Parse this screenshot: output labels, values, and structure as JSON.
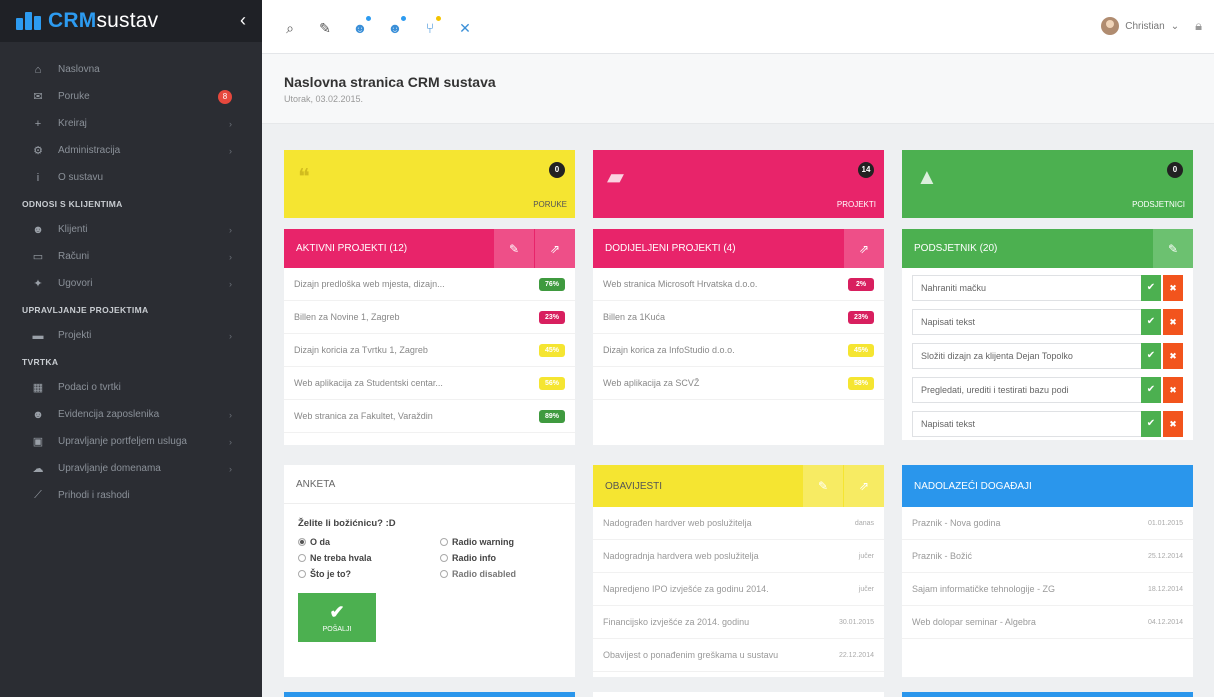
{
  "brand": {
    "name_bold": "CRM",
    "name_rest": "sustav",
    "toggle": "‹"
  },
  "sidebar": {
    "items": [
      {
        "label": "Naslovna",
        "icon": "home-icon",
        "glyph": "⌂"
      },
      {
        "label": "Poruke",
        "icon": "chat-icon",
        "glyph": "✉",
        "badge": "8"
      },
      {
        "label": "Kreiraj",
        "icon": "plus-icon",
        "glyph": "+",
        "arrow": true
      },
      {
        "label": "Administracija",
        "icon": "cogs-icon",
        "glyph": "⚙",
        "arrow": true
      },
      {
        "label": "O sustavu",
        "icon": "info-icon",
        "glyph": "i"
      }
    ],
    "section1": "ODNOSI S KLIJENTIMA",
    "items2": [
      {
        "label": "Klijenti",
        "icon": "users-icon",
        "glyph": "☻",
        "arrow": true
      },
      {
        "label": "Računi",
        "icon": "card-icon",
        "glyph": "▭",
        "arrow": true
      },
      {
        "label": "Ugovori",
        "icon": "handshake-icon",
        "glyph": "✦",
        "arrow": true
      }
    ],
    "section2": "UPRAVLJANJE PROJEKTIMA",
    "items3": [
      {
        "label": "Projekti",
        "icon": "folder-icon",
        "glyph": "▬",
        "arrow": true
      }
    ],
    "section3": "TVRTKA",
    "items4": [
      {
        "label": "Podaci o tvrtki",
        "icon": "building-icon",
        "glyph": "▦"
      },
      {
        "label": "Evidencija zaposlenika",
        "icon": "employees-icon",
        "glyph": "☻",
        "arrow": true
      },
      {
        "label": "Upravljanje portfeljem usluga",
        "icon": "portfolio-icon",
        "glyph": "▣",
        "arrow": true
      },
      {
        "label": "Upravljanje domenama",
        "icon": "cloud-icon",
        "glyph": "☁",
        "arrow": true
      },
      {
        "label": "Prihodi i rashodi",
        "icon": "line-chart-icon",
        "glyph": "⟋"
      }
    ]
  },
  "topbar": {
    "icons": [
      "search-icon",
      "wrench-icon",
      "user-add-icon",
      "users-icon",
      "hierarchy-icon",
      "fullscreen-icon"
    ],
    "user_name": "Christian",
    "user_caret": "⌄"
  },
  "page": {
    "title": "Naslovna stranica CRM sustava",
    "date": "Utorak, 03.02.2015."
  },
  "tiles": [
    {
      "count": "0",
      "label": "PORUKE",
      "icon": "chat-icon"
    },
    {
      "count": "14",
      "label": "PROJEKTI",
      "icon": "folder-icon"
    },
    {
      "count": "0",
      "label": "PODSJETNICI",
      "icon": "bell-icon"
    }
  ],
  "active_projects": {
    "title": "AKTIVNI PROJEKTI (12)",
    "rows": [
      {
        "name": "Dizajn predloška web mjesta, dizajn...",
        "pct": "76%",
        "color": "green"
      },
      {
        "name": "Billen za Novine 1, Zagreb",
        "pct": "23%",
        "color": "red"
      },
      {
        "name": "Dizajn koricia za Tvrtku 1, Zagreb",
        "pct": "45%",
        "color": "yellow"
      },
      {
        "name": "Web aplikacija za Studentski centar...",
        "pct": "56%",
        "color": "yellow"
      },
      {
        "name": "Web stranica za Fakultet, Varaždin",
        "pct": "89%",
        "color": "green"
      }
    ]
  },
  "assigned_projects": {
    "title": "DODIJELJENI PROJEKTI (4)",
    "rows": [
      {
        "name": "Web stranica Microsoft Hrvatska d.o.o.",
        "pct": "2%",
        "color": "red"
      },
      {
        "name": "Billen za 1Kuća",
        "pct": "23%",
        "color": "red"
      },
      {
        "name": "Dizajn korica za InfoStudio d.o.o.",
        "pct": "45%",
        "color": "yellow"
      },
      {
        "name": "Web aplikacija za SCVŽ",
        "pct": "58%",
        "color": "yellow"
      }
    ]
  },
  "reminders": {
    "title": "PODSJETNIK (20)",
    "rows": [
      "Nahraniti mačku",
      "Napisati tekst",
      "Složiti dizajn za klijenta Dejan Topolko",
      "Pregledati, urediti i testirati bazu podi",
      "Napisati tekst"
    ]
  },
  "poll": {
    "title": "ANKETA",
    "question": "Želite li božićnicu? :D",
    "options": [
      {
        "label": "O da",
        "checked": true
      },
      {
        "label": "Radio warning",
        "checked": false
      },
      {
        "label": "Ne treba hvala",
        "checked": false
      },
      {
        "label": "Radio info",
        "checked": false
      },
      {
        "label": "Što je to?",
        "checked": false
      },
      {
        "label": "Radio disabled",
        "checked": false,
        "disabled": true
      }
    ],
    "submit": "POŠALJI"
  },
  "notices": {
    "title": "OBAVIJESTI",
    "rows": [
      {
        "text": "Nadograđen hardver web poslužitelja",
        "time": "danas"
      },
      {
        "text": "Nadogradnja hardvera web poslužitelja",
        "time": "jučer"
      },
      {
        "text": "Napredjeno IPO izvješće za godinu 2014.",
        "time": "jučer"
      },
      {
        "text": "Financijsko izvješće za 2014. godinu",
        "time": "30.01.2015"
      },
      {
        "text": "Obavijest o ponađenim greškama u sustavu",
        "time": "22.12.2014"
      }
    ]
  },
  "events": {
    "title": "NADOLAZEĆI DOGAĐAJI",
    "rows": [
      {
        "text": "Praznik - Nova godina",
        "time": "01.01.2015"
      },
      {
        "text": "Praznik - Božić",
        "time": "25.12.2014"
      },
      {
        "text": "Sajam informatičke tehnologije - ZG",
        "time": "18.12.2014"
      },
      {
        "text": "Web dolopar seminar - Algebra",
        "time": "04.12.2014"
      }
    ]
  }
}
